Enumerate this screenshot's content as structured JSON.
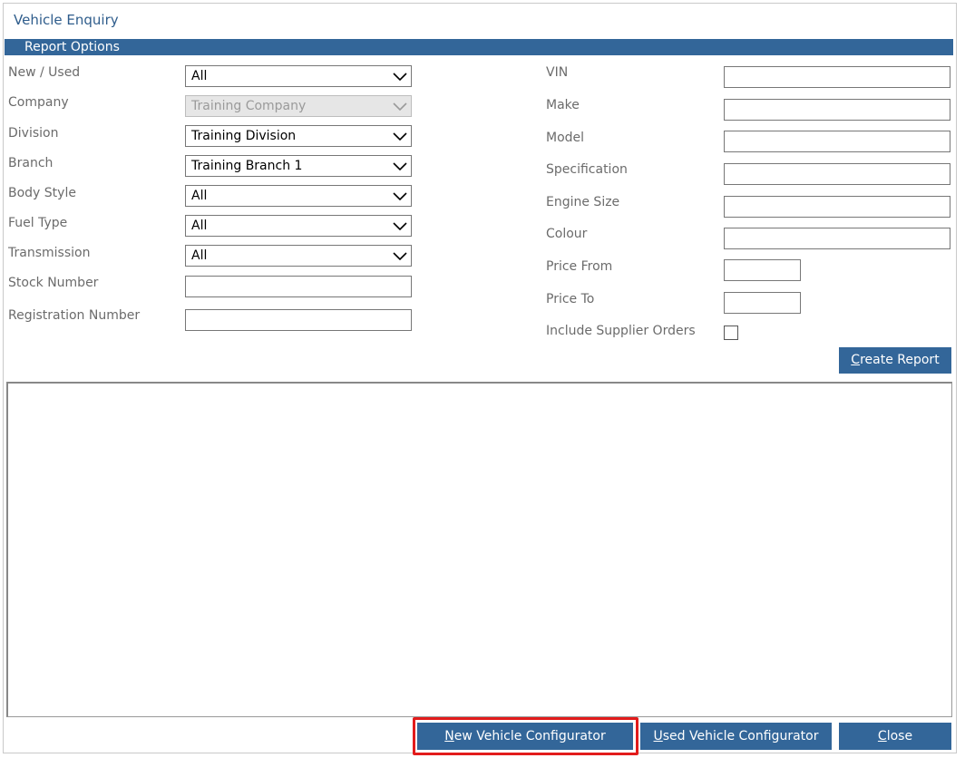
{
  "window": {
    "title": "Vehicle Enquiry"
  },
  "section": {
    "label": "Report Options"
  },
  "left_fields": [
    {
      "label": "New / Used",
      "value": "All"
    },
    {
      "label": "Company",
      "value": "Training Company"
    },
    {
      "label": "Division",
      "value": "Training Division"
    },
    {
      "label": "Branch",
      "value": "Training Branch 1"
    },
    {
      "label": "Body Style",
      "value": "All"
    },
    {
      "label": "Fuel Type",
      "value": "All"
    },
    {
      "label": "Transmission",
      "value": "All"
    },
    {
      "label": "Stock Number",
      "value": ""
    },
    {
      "label": "Registration Number",
      "value": ""
    }
  ],
  "right_fields": [
    {
      "label": "VIN",
      "value": ""
    },
    {
      "label": "Make",
      "value": ""
    },
    {
      "label": "Model",
      "value": ""
    },
    {
      "label": "Specification",
      "value": ""
    },
    {
      "label": "Engine Size",
      "value": ""
    },
    {
      "label": "Colour",
      "value": ""
    },
    {
      "label": "Price From",
      "value": ""
    },
    {
      "label": "Price To",
      "value": ""
    },
    {
      "label": "Include Supplier Orders",
      "checked": false
    }
  ],
  "buttons": {
    "create_report": {
      "access_key": "C",
      "rest": "reate Report"
    },
    "new_config": {
      "access_key": "N",
      "rest": "ew Vehicle Configurator"
    },
    "used_config": {
      "access_key": "U",
      "rest": "sed Vehicle Configurator"
    },
    "close": {
      "access_key": "C",
      "rest": "lose"
    }
  },
  "colors": {
    "accent": "#336699",
    "highlight": "#e21b1b"
  }
}
